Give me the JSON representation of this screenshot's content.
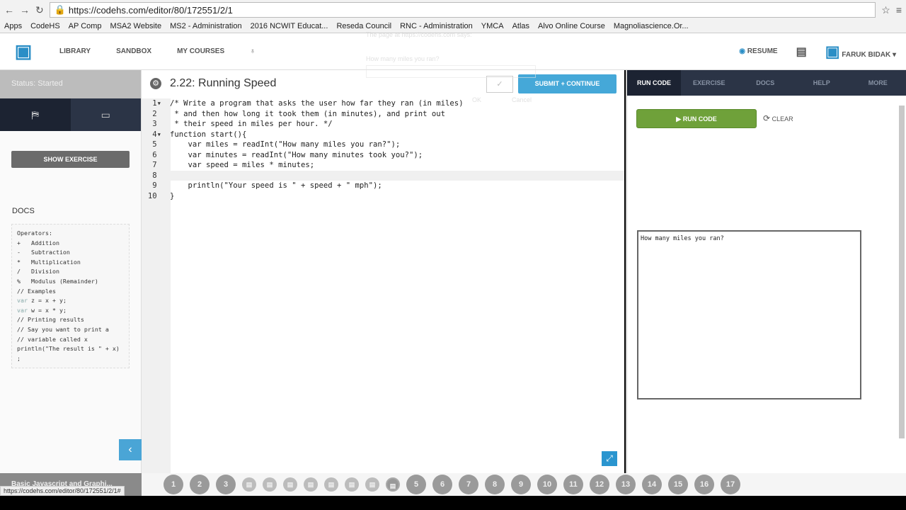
{
  "browser": {
    "url": "https://codehs.com/editor/80/172551/2/1",
    "status_url": "https://codehs.com/editor/80/172551/2/1#",
    "bookmarks": [
      "Apps",
      "CodeHS",
      "AP Comp",
      "MSA2 Website",
      "MS2 - Administration",
      "2016 NCWIT Educat...",
      "Reseda Council",
      "RNC - Administration",
      "YMCA",
      "Atlas",
      "Alvo Online Course",
      "Magnoliascience.Or..."
    ]
  },
  "nav": {
    "library": "LIBRARY",
    "sandbox": "SANDBOX",
    "my_courses": "MY COURSES",
    "resume": "RESUME",
    "user": "FARUK BIDAK"
  },
  "dialog": {
    "title": "The page at https://codehs.com says:",
    "prompt": "How many miles you ran?",
    "ok": "OK",
    "cancel": "Cancel"
  },
  "sidebar": {
    "status": "Status: Started",
    "show_exercise": "SHOW EXERCISE",
    "docs_title": "DOCS",
    "docs_lines": [
      [
        "",
        "Operators:"
      ],
      [
        "",
        "+   Addition"
      ],
      [
        "",
        "-   Subtraction"
      ],
      [
        "",
        "*   Multiplication"
      ],
      [
        "",
        "/   Division"
      ],
      [
        "",
        "%   Modulus (Remainder)"
      ],
      [
        "",
        ""
      ],
      [
        "",
        "// Examples"
      ],
      [
        "var",
        " z = x + y;"
      ],
      [
        "var",
        " w = x * y;"
      ],
      [
        "",
        ""
      ],
      [
        "",
        "// Printing results"
      ],
      [
        "",
        "// Say you want to print a"
      ],
      [
        "",
        "// variable called x"
      ],
      [
        "",
        "println(\"The result is \" + x)"
      ],
      [
        "",
        ";"
      ]
    ]
  },
  "editor": {
    "title": "2.22: Running Speed",
    "submit": "SUBMIT + CONTINUE",
    "check": "✓",
    "lines": [
      "/* Write a program that asks the user how far they ran (in miles)",
      " * and then how long it took them (in minutes), and print out",
      " * their speed in miles per hour. */",
      "function start(){",
      "    var miles = readInt(\"How many miles you ran?\");",
      "    var minutes = readInt(\"How many minutes took you?\");",
      "    var speed = miles * minutes;",
      "    ",
      "    println(\"Your speed is \" + speed + \" mph\");",
      "}"
    ]
  },
  "right": {
    "tabs": [
      "RUN CODE",
      "EXERCISE",
      "DOCS",
      "HELP",
      "MORE"
    ],
    "run": "RUN CODE",
    "clear": "CLEAR",
    "console": "How many miles you ran?"
  },
  "bottom": {
    "unit": "Basic Javascript and Graphi...",
    "items": [
      "1",
      "2",
      "3",
      "",
      "",
      "",
      "",
      "",
      "",
      "",
      "",
      "5",
      "6",
      "7",
      "8",
      "9",
      "10",
      "11",
      "12",
      "13",
      "14",
      "15",
      "16",
      "17"
    ]
  }
}
